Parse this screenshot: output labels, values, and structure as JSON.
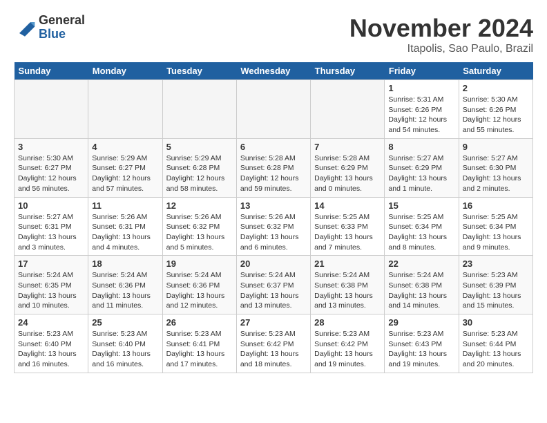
{
  "logo": {
    "general": "General",
    "blue": "Blue"
  },
  "title": "November 2024",
  "location": "Itapolis, Sao Paulo, Brazil",
  "days_of_week": [
    "Sunday",
    "Monday",
    "Tuesday",
    "Wednesday",
    "Thursday",
    "Friday",
    "Saturday"
  ],
  "weeks": [
    [
      {
        "day": "",
        "info": ""
      },
      {
        "day": "",
        "info": ""
      },
      {
        "day": "",
        "info": ""
      },
      {
        "day": "",
        "info": ""
      },
      {
        "day": "",
        "info": ""
      },
      {
        "day": "1",
        "info": "Sunrise: 5:31 AM\nSunset: 6:26 PM\nDaylight: 12 hours\nand 54 minutes."
      },
      {
        "day": "2",
        "info": "Sunrise: 5:30 AM\nSunset: 6:26 PM\nDaylight: 12 hours\nand 55 minutes."
      }
    ],
    [
      {
        "day": "3",
        "info": "Sunrise: 5:30 AM\nSunset: 6:27 PM\nDaylight: 12 hours\nand 56 minutes."
      },
      {
        "day": "4",
        "info": "Sunrise: 5:29 AM\nSunset: 6:27 PM\nDaylight: 12 hours\nand 57 minutes."
      },
      {
        "day": "5",
        "info": "Sunrise: 5:29 AM\nSunset: 6:28 PM\nDaylight: 12 hours\nand 58 minutes."
      },
      {
        "day": "6",
        "info": "Sunrise: 5:28 AM\nSunset: 6:28 PM\nDaylight: 12 hours\nand 59 minutes."
      },
      {
        "day": "7",
        "info": "Sunrise: 5:28 AM\nSunset: 6:29 PM\nDaylight: 13 hours\nand 0 minutes."
      },
      {
        "day": "8",
        "info": "Sunrise: 5:27 AM\nSunset: 6:29 PM\nDaylight: 13 hours\nand 1 minute."
      },
      {
        "day": "9",
        "info": "Sunrise: 5:27 AM\nSunset: 6:30 PM\nDaylight: 13 hours\nand 2 minutes."
      }
    ],
    [
      {
        "day": "10",
        "info": "Sunrise: 5:27 AM\nSunset: 6:31 PM\nDaylight: 13 hours\nand 3 minutes."
      },
      {
        "day": "11",
        "info": "Sunrise: 5:26 AM\nSunset: 6:31 PM\nDaylight: 13 hours\nand 4 minutes."
      },
      {
        "day": "12",
        "info": "Sunrise: 5:26 AM\nSunset: 6:32 PM\nDaylight: 13 hours\nand 5 minutes."
      },
      {
        "day": "13",
        "info": "Sunrise: 5:26 AM\nSunset: 6:32 PM\nDaylight: 13 hours\nand 6 minutes."
      },
      {
        "day": "14",
        "info": "Sunrise: 5:25 AM\nSunset: 6:33 PM\nDaylight: 13 hours\nand 7 minutes."
      },
      {
        "day": "15",
        "info": "Sunrise: 5:25 AM\nSunset: 6:34 PM\nDaylight: 13 hours\nand 8 minutes."
      },
      {
        "day": "16",
        "info": "Sunrise: 5:25 AM\nSunset: 6:34 PM\nDaylight: 13 hours\nand 9 minutes."
      }
    ],
    [
      {
        "day": "17",
        "info": "Sunrise: 5:24 AM\nSunset: 6:35 PM\nDaylight: 13 hours\nand 10 minutes."
      },
      {
        "day": "18",
        "info": "Sunrise: 5:24 AM\nSunset: 6:36 PM\nDaylight: 13 hours\nand 11 minutes."
      },
      {
        "day": "19",
        "info": "Sunrise: 5:24 AM\nSunset: 6:36 PM\nDaylight: 13 hours\nand 12 minutes."
      },
      {
        "day": "20",
        "info": "Sunrise: 5:24 AM\nSunset: 6:37 PM\nDaylight: 13 hours\nand 13 minutes."
      },
      {
        "day": "21",
        "info": "Sunrise: 5:24 AM\nSunset: 6:38 PM\nDaylight: 13 hours\nand 13 minutes."
      },
      {
        "day": "22",
        "info": "Sunrise: 5:24 AM\nSunset: 6:38 PM\nDaylight: 13 hours\nand 14 minutes."
      },
      {
        "day": "23",
        "info": "Sunrise: 5:23 AM\nSunset: 6:39 PM\nDaylight: 13 hours\nand 15 minutes."
      }
    ],
    [
      {
        "day": "24",
        "info": "Sunrise: 5:23 AM\nSunset: 6:40 PM\nDaylight: 13 hours\nand 16 minutes."
      },
      {
        "day": "25",
        "info": "Sunrise: 5:23 AM\nSunset: 6:40 PM\nDaylight: 13 hours\nand 16 minutes."
      },
      {
        "day": "26",
        "info": "Sunrise: 5:23 AM\nSunset: 6:41 PM\nDaylight: 13 hours\nand 17 minutes."
      },
      {
        "day": "27",
        "info": "Sunrise: 5:23 AM\nSunset: 6:42 PM\nDaylight: 13 hours\nand 18 minutes."
      },
      {
        "day": "28",
        "info": "Sunrise: 5:23 AM\nSunset: 6:42 PM\nDaylight: 13 hours\nand 19 minutes."
      },
      {
        "day": "29",
        "info": "Sunrise: 5:23 AM\nSunset: 6:43 PM\nDaylight: 13 hours\nand 19 minutes."
      },
      {
        "day": "30",
        "info": "Sunrise: 5:23 AM\nSunset: 6:44 PM\nDaylight: 13 hours\nand 20 minutes."
      }
    ]
  ]
}
